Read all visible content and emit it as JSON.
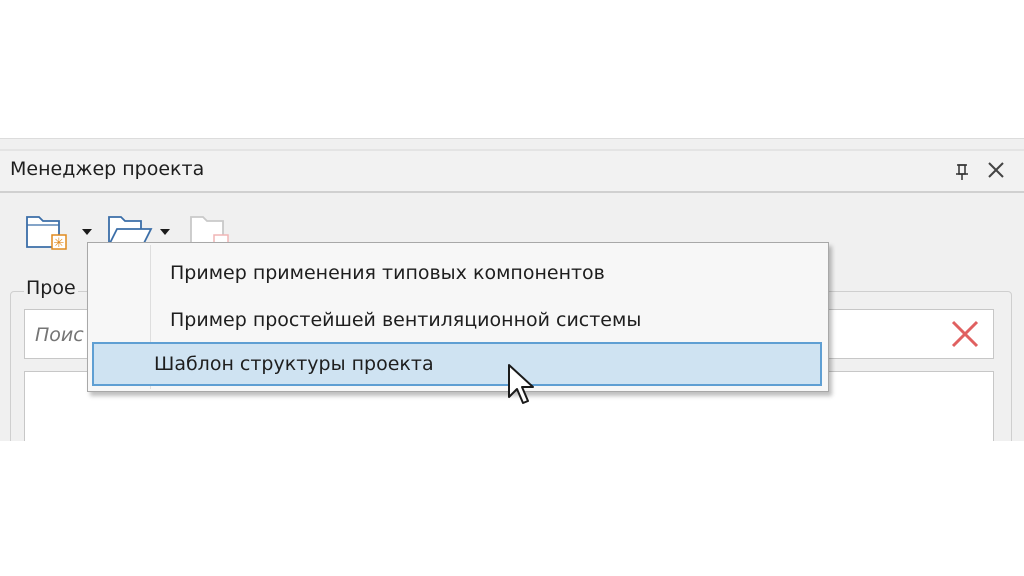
{
  "panel": {
    "title": "Менеджер проекта",
    "pin_icon": "pin-icon",
    "close_icon": "close-icon"
  },
  "toolbar": {
    "buttons": [
      {
        "icon": "new-project-folder-icon",
        "has_dropdown": true
      },
      {
        "icon": "open-folder-icon",
        "has_dropdown": true
      },
      {
        "icon": "close-project-folder-icon",
        "disabled": true
      }
    ]
  },
  "projects_group": {
    "label": "Прое"
  },
  "search": {
    "placeholder": "Поис",
    "value": "",
    "clear_icon": "clear-icon",
    "clear_color": "#e06060"
  },
  "menu": {
    "items": [
      {
        "label": "Пример применения типовых компонентов"
      },
      {
        "label": "Пример простейшей вентиляционной системы"
      },
      {
        "label": "Шаблон структуры проекта",
        "highlighted": true
      }
    ],
    "highlight_color": "#cfe3f2",
    "highlight_border": "#5f9fd3"
  },
  "cursor_icon": "mouse-pointer-icon"
}
